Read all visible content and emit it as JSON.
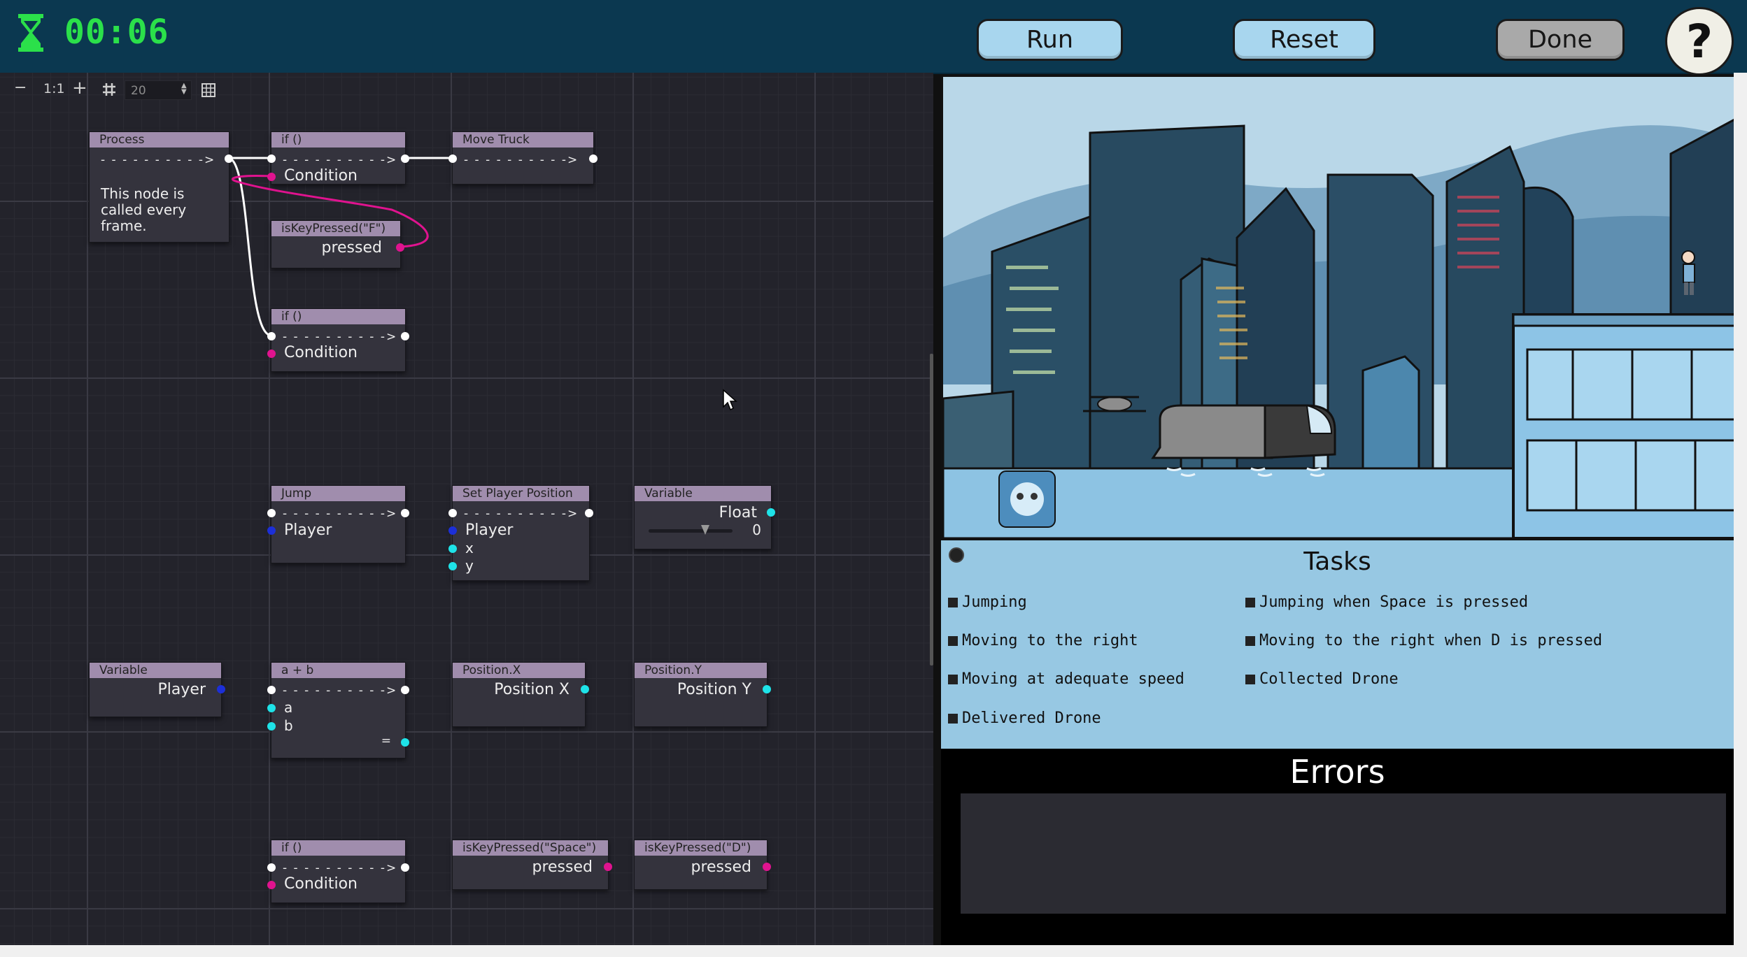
{
  "header": {
    "timer": "00:06",
    "run_label": "Run",
    "reset_label": "Reset",
    "done_label": "Done",
    "help_label": "?",
    "hourglass_icon": "hourglass-icon",
    "timer_color": "#2be04a",
    "bar_color": "#0b3850"
  },
  "toolbar": {
    "zoom_out": "−",
    "zoom_reset": "1:1",
    "zoom_in": "+",
    "snap_icon": "snap-grid-icon",
    "snap_value": "20",
    "minimap_icon": "minimap-icon"
  },
  "nodes": {
    "process": {
      "title": "Process",
      "text1": "This node is",
      "text2": "called every",
      "text3": "frame."
    },
    "if1": {
      "title": "if ()",
      "condition": "Condition"
    },
    "move_truck": {
      "title": "Move Truck"
    },
    "iskey_f": {
      "title": "isKeyPressed(\"F\")",
      "pressed": "pressed"
    },
    "if2": {
      "title": "if ()",
      "condition": "Condition"
    },
    "jump": {
      "title": "Jump",
      "player": "Player"
    },
    "set_player_position": {
      "title": "Set Player Position",
      "player": "Player",
      "x": "x",
      "y": "y"
    },
    "variable_float": {
      "title": "Variable",
      "type": "Float",
      "value": "0"
    },
    "variable_player": {
      "title": "Variable",
      "value": "Player"
    },
    "add": {
      "title": "a + b",
      "a": "a",
      "b": "b",
      "eq": "="
    },
    "position_x": {
      "title": "Position.X",
      "value": "Position X"
    },
    "position_y": {
      "title": "Position.Y",
      "value": "Position Y"
    },
    "if3": {
      "title": "if ()",
      "condition": "Condition"
    },
    "iskey_space": {
      "title": "isKeyPressed(\"Space\")",
      "pressed": "pressed"
    },
    "iskey_d": {
      "title": "isKeyPressed(\"D\")",
      "pressed": "pressed"
    },
    "dash": "- - - - - - - - - ->"
  },
  "tasks": {
    "title": "Tasks",
    "items": [
      "Jumping",
      "Jumping when Space is pressed",
      "Moving to the right",
      "Moving to the right when D is pressed",
      "Moving at adequate speed",
      "Collected Drone",
      "Delivered Drone"
    ]
  },
  "errors": {
    "title": "Errors"
  }
}
